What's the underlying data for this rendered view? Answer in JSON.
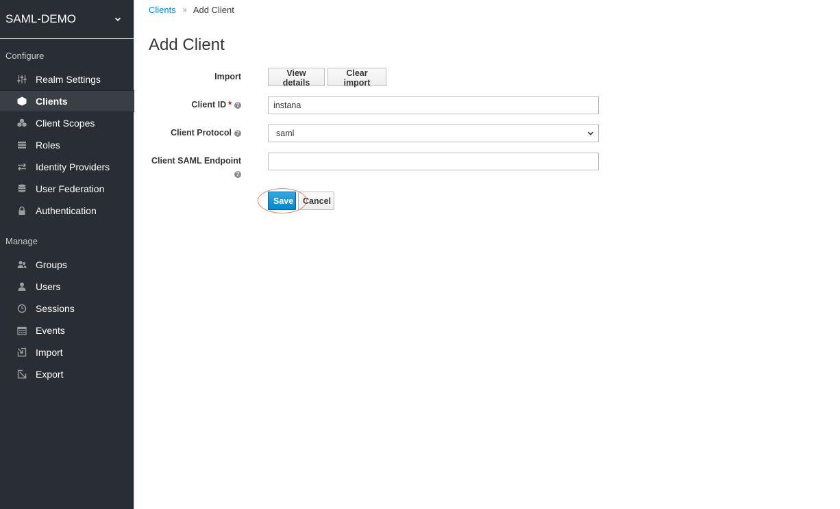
{
  "sidebar": {
    "realm_name": "SAML-DEMO",
    "configure_label": "Configure",
    "manage_label": "Manage",
    "configure_items": [
      {
        "label": "Realm Settings",
        "icon": "sliders-icon"
      },
      {
        "label": "Clients",
        "icon": "cube-icon",
        "active": true
      },
      {
        "label": "Client Scopes",
        "icon": "cubes-icon"
      },
      {
        "label": "Roles",
        "icon": "list-icon"
      },
      {
        "label": "Identity Providers",
        "icon": "exchange-icon"
      },
      {
        "label": "User Federation",
        "icon": "database-icon"
      },
      {
        "label": "Authentication",
        "icon": "lock-icon"
      }
    ],
    "manage_items": [
      {
        "label": "Groups",
        "icon": "users-icon"
      },
      {
        "label": "Users",
        "icon": "user-icon"
      },
      {
        "label": "Sessions",
        "icon": "clock-icon"
      },
      {
        "label": "Events",
        "icon": "calendar-icon"
      },
      {
        "label": "Import",
        "icon": "import-icon"
      },
      {
        "label": "Export",
        "icon": "export-icon"
      }
    ]
  },
  "breadcrumb": {
    "parent": "Clients",
    "separator": "»",
    "current": "Add Client"
  },
  "page": {
    "title": "Add Client"
  },
  "form": {
    "import_label": "Import",
    "view_details_button": "View details",
    "clear_import_button": "Clear import",
    "client_id_label": "Client ID",
    "client_id_required": "*",
    "client_id_value": "instana",
    "client_protocol_label": "Client Protocol",
    "client_protocol_value": "saml",
    "saml_endpoint_label_line1": "Client SAML Endpoint",
    "saml_endpoint_value": "",
    "help_glyph": "?",
    "save_button": "Save",
    "cancel_button": "Cancel"
  },
  "colors": {
    "sidebar_bg": "#292e34",
    "link": "#0088ce",
    "primary": "#0088ce",
    "highlight_ring": "#e9826e"
  }
}
